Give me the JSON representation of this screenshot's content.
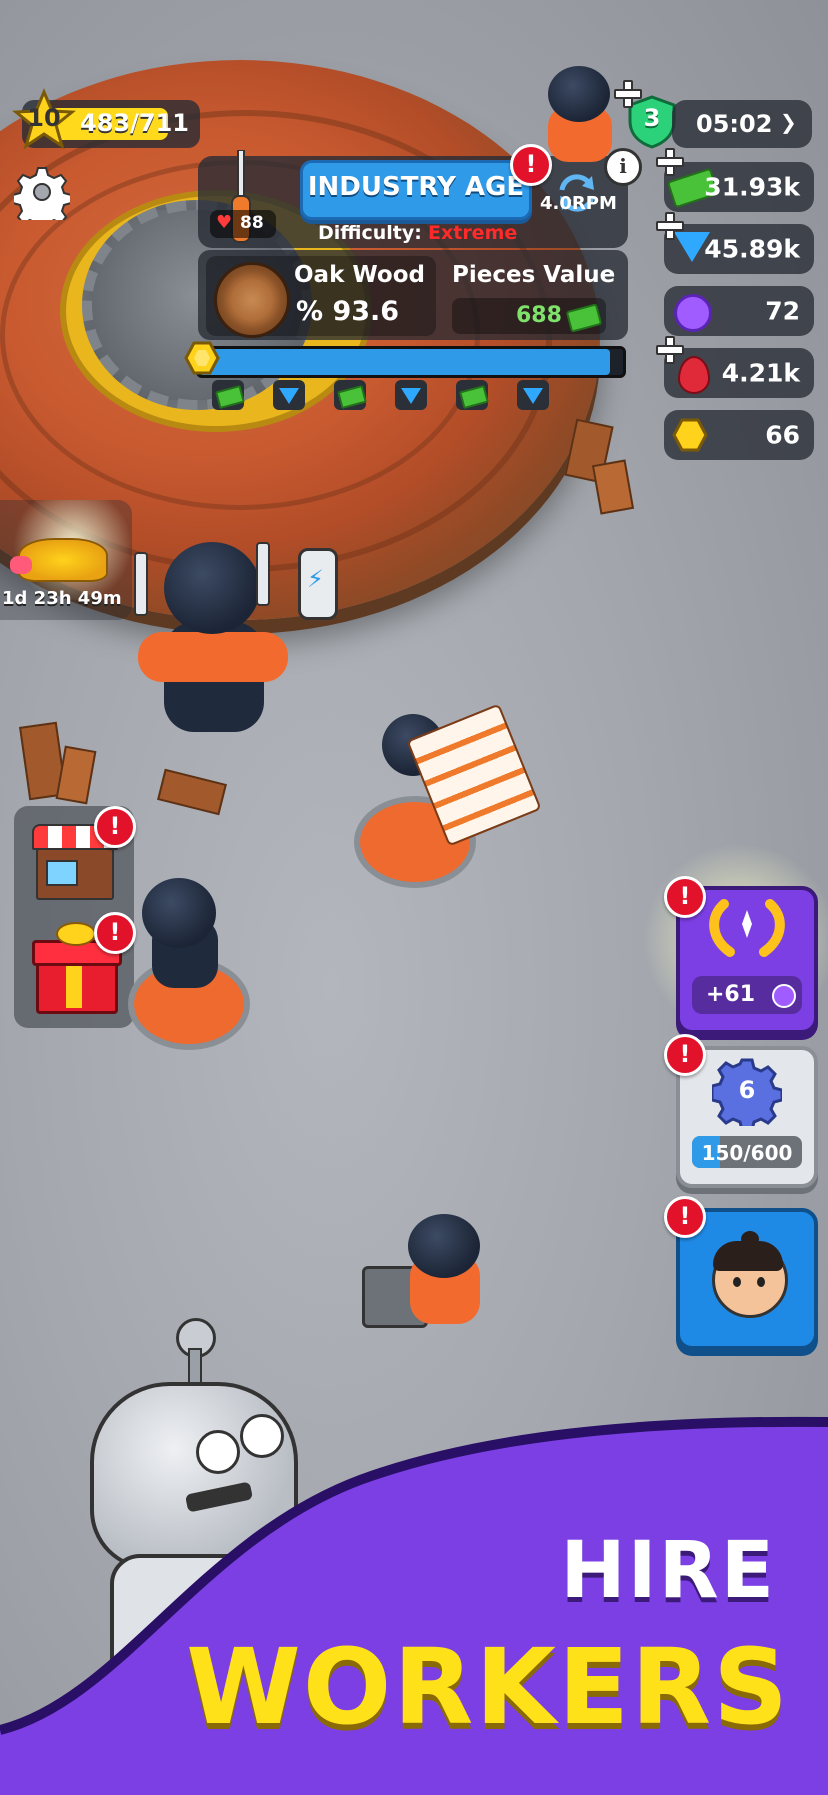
{
  "hud": {
    "level": "10",
    "xp": "483/711",
    "timer": "05:02",
    "prestige_rank": "3"
  },
  "resources": {
    "cash": "31.93k",
    "gems": "45.89k",
    "tokens": "72",
    "blood": "4.21k",
    "coins": "66"
  },
  "info_panel": {
    "age_title": "INDUSTRY AGE",
    "difficulty_label": "Difficulty:",
    "difficulty_value": "Extreme",
    "rpm": "4.0RPM",
    "health": "88",
    "material_name": "Oak Wood",
    "material_percent": "% 93.6",
    "pieces_value_label": "Pieces Value",
    "pieces_value": "688"
  },
  "chest": {
    "timer": "1d 23h 49m"
  },
  "right_buttons": {
    "laurel_reward": "+61",
    "gear_level": "6",
    "gear_progress": "150/600",
    "gear_progress_fraction": 0.25
  },
  "progress": {
    "fill_fraction": 0.97,
    "milestones": [
      "cash",
      "gem",
      "cash",
      "gem",
      "cash",
      "gem"
    ]
  },
  "banner": {
    "line1": "HIRE",
    "line2": "WORKERS"
  },
  "colors": {
    "accent_purple": "#7b3fe4",
    "banner_yellow": "#ffe11a",
    "difficulty_red": "#ff2a2a",
    "cash_green": "#49c23a",
    "age_blue": "#2f9be8"
  }
}
